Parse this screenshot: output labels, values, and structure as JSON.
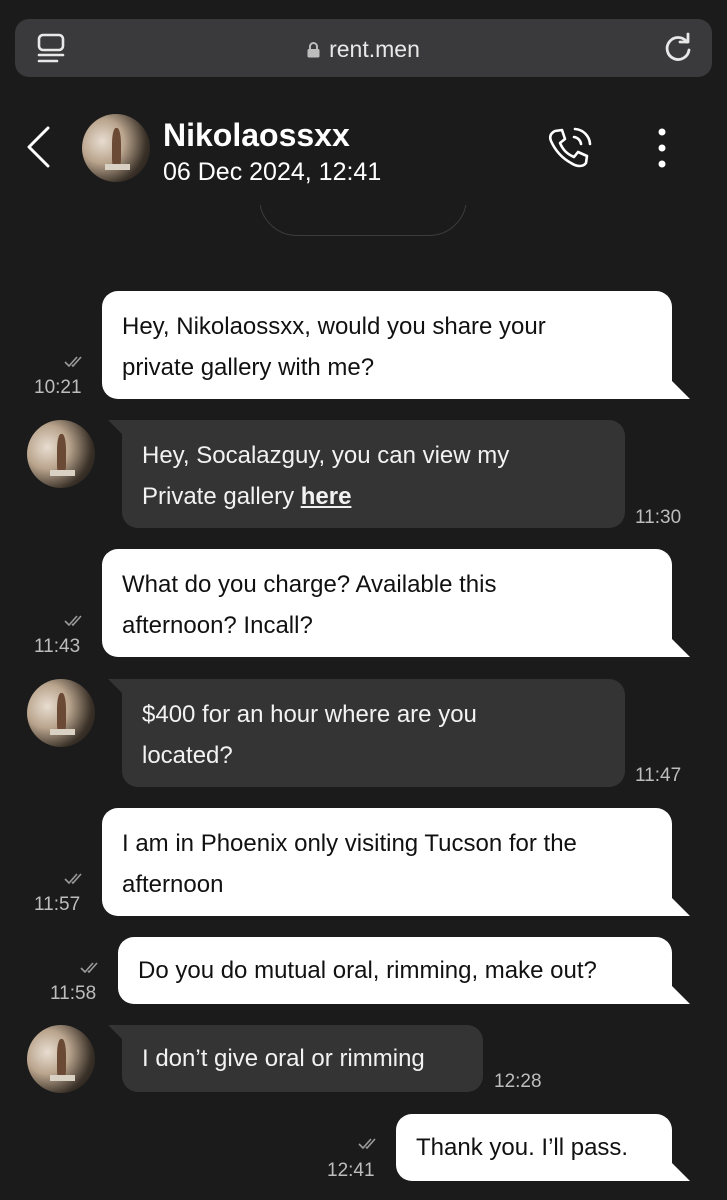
{
  "browser": {
    "url": "rent.men"
  },
  "header": {
    "name": "Nikolaossxx",
    "date": "06 Dec 2024, 12:41"
  },
  "messages": [
    {
      "dir": "out",
      "lines": [
        "Hey, Nikolaossxx, would you share your",
        "private gallery with me?"
      ],
      "time": "10:21"
    },
    {
      "dir": "in",
      "line1": "Hey, Socalazguy, you can view my",
      "line2_prefix": "Private gallery ",
      "link": "here",
      "time": "11:30"
    },
    {
      "dir": "out",
      "lines": [
        "What do you charge? Available this",
        "afternoon? Incall?"
      ],
      "time": "11:43"
    },
    {
      "dir": "in",
      "lines": [
        "$400 for an hour where are you",
        "located?"
      ],
      "time": "11:47"
    },
    {
      "dir": "out",
      "lines": [
        "I am in Phoenix only visiting Tucson for the",
        "afternoon"
      ],
      "time": "11:57"
    },
    {
      "dir": "out",
      "lines": [
        "Do you do mutual oral, rimming, make out?"
      ],
      "time": "11:58"
    },
    {
      "dir": "in",
      "lines": [
        "I don’t give oral or rimming"
      ],
      "time": "12:28"
    },
    {
      "dir": "out",
      "lines": [
        "Thank you. I’ll pass."
      ],
      "time": "12:41"
    }
  ],
  "colors": {
    "background": "#1b1b1b",
    "outgoing_bubble": "#ffffff",
    "incoming_bubble": "#343434"
  },
  "icons": [
    "tabs-icon",
    "lock-icon",
    "reload-icon",
    "back-icon",
    "call-icon",
    "more-icon",
    "read-ticks-icon"
  ]
}
